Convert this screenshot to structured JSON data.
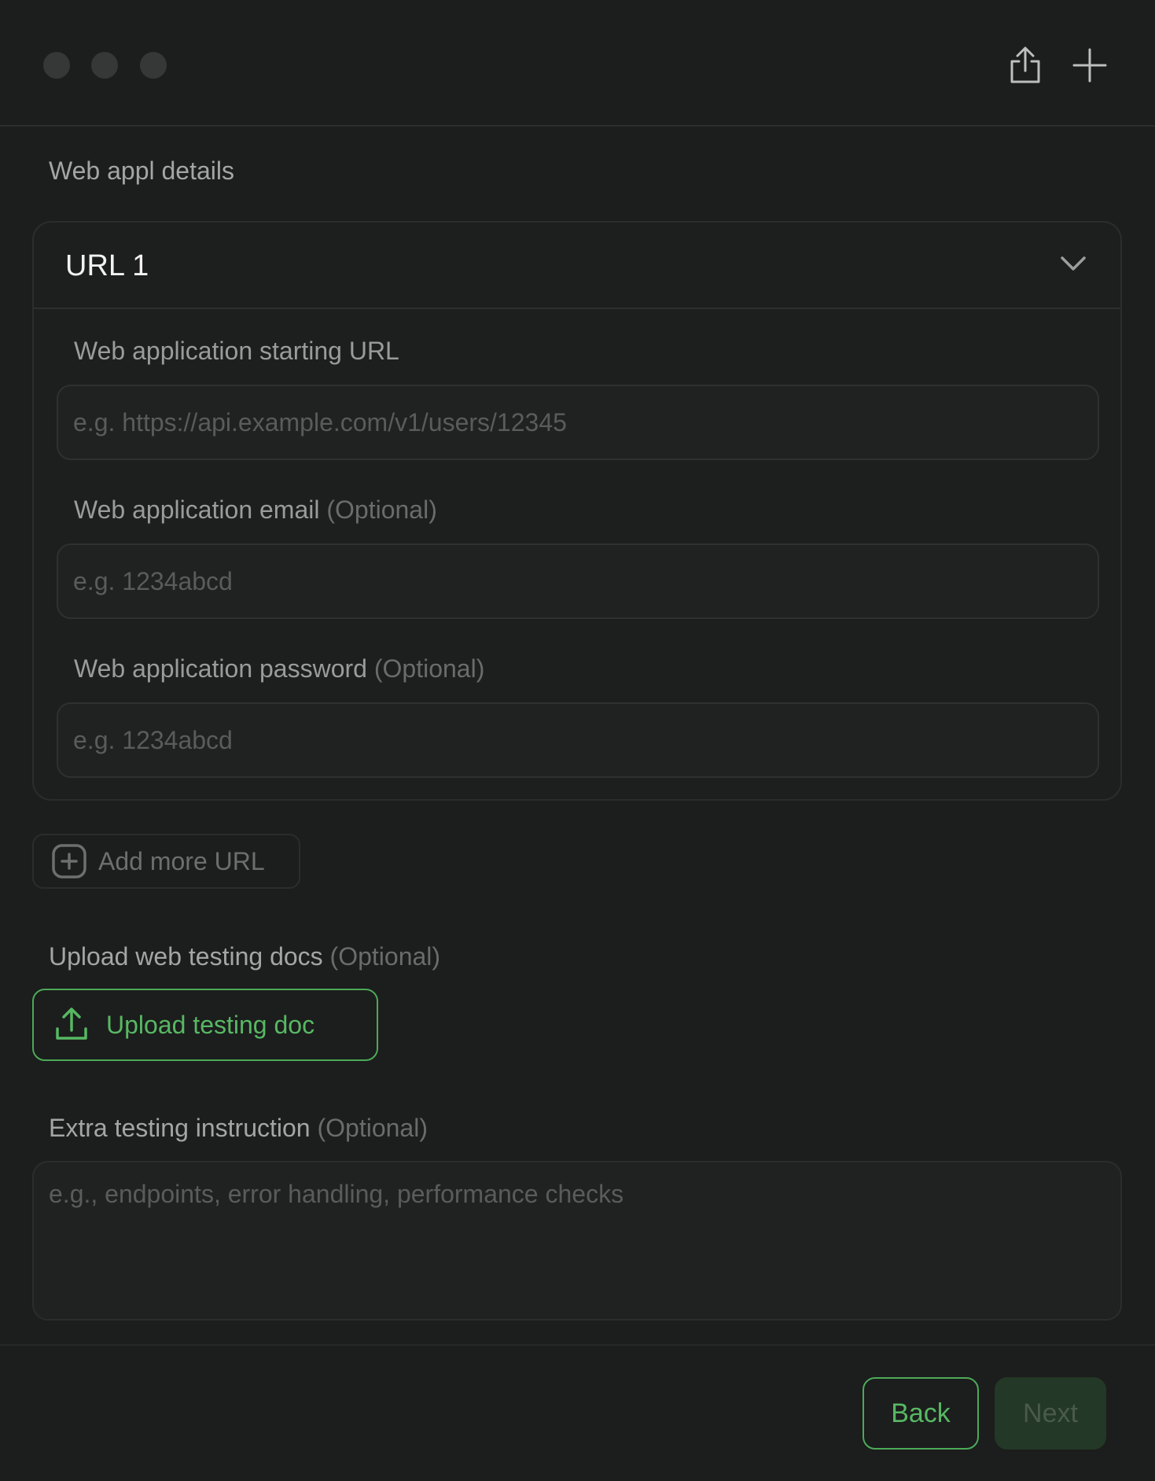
{
  "titlebar": {
    "dots": [
      "window-dot",
      "window-dot",
      "window-dot"
    ],
    "actions": {
      "share_icon": "share-icon",
      "plus_icon": "plus-icon"
    }
  },
  "section": {
    "title": "Web appl details"
  },
  "url_card": {
    "title": "URL 1",
    "fields": {
      "starting_url": {
        "label": "Web application starting URL",
        "placeholder": "e.g. https://api.example.com/v1/users/12345"
      },
      "email": {
        "label": "Web application email",
        "optional": "(Optional)",
        "placeholder": "e.g. 1234abcd"
      },
      "password": {
        "label": "Web application password",
        "optional": "(Optional)",
        "placeholder": "e.g. 1234abcd"
      }
    }
  },
  "add_url": {
    "label": "Add more URL"
  },
  "upload": {
    "label": "Upload web testing docs",
    "optional": "(Optional)",
    "button_label": "Upload testing doc"
  },
  "instructions": {
    "label": "Extra testing instruction",
    "optional": "(Optional)",
    "placeholder": "e.g., endpoints, error handling, performance checks"
  },
  "footer": {
    "back_label": "Back",
    "next_label": "Next"
  },
  "colors": {
    "background": "#1c1d1d",
    "accent": "#57b863",
    "next_disabled_bg": "#233826"
  }
}
